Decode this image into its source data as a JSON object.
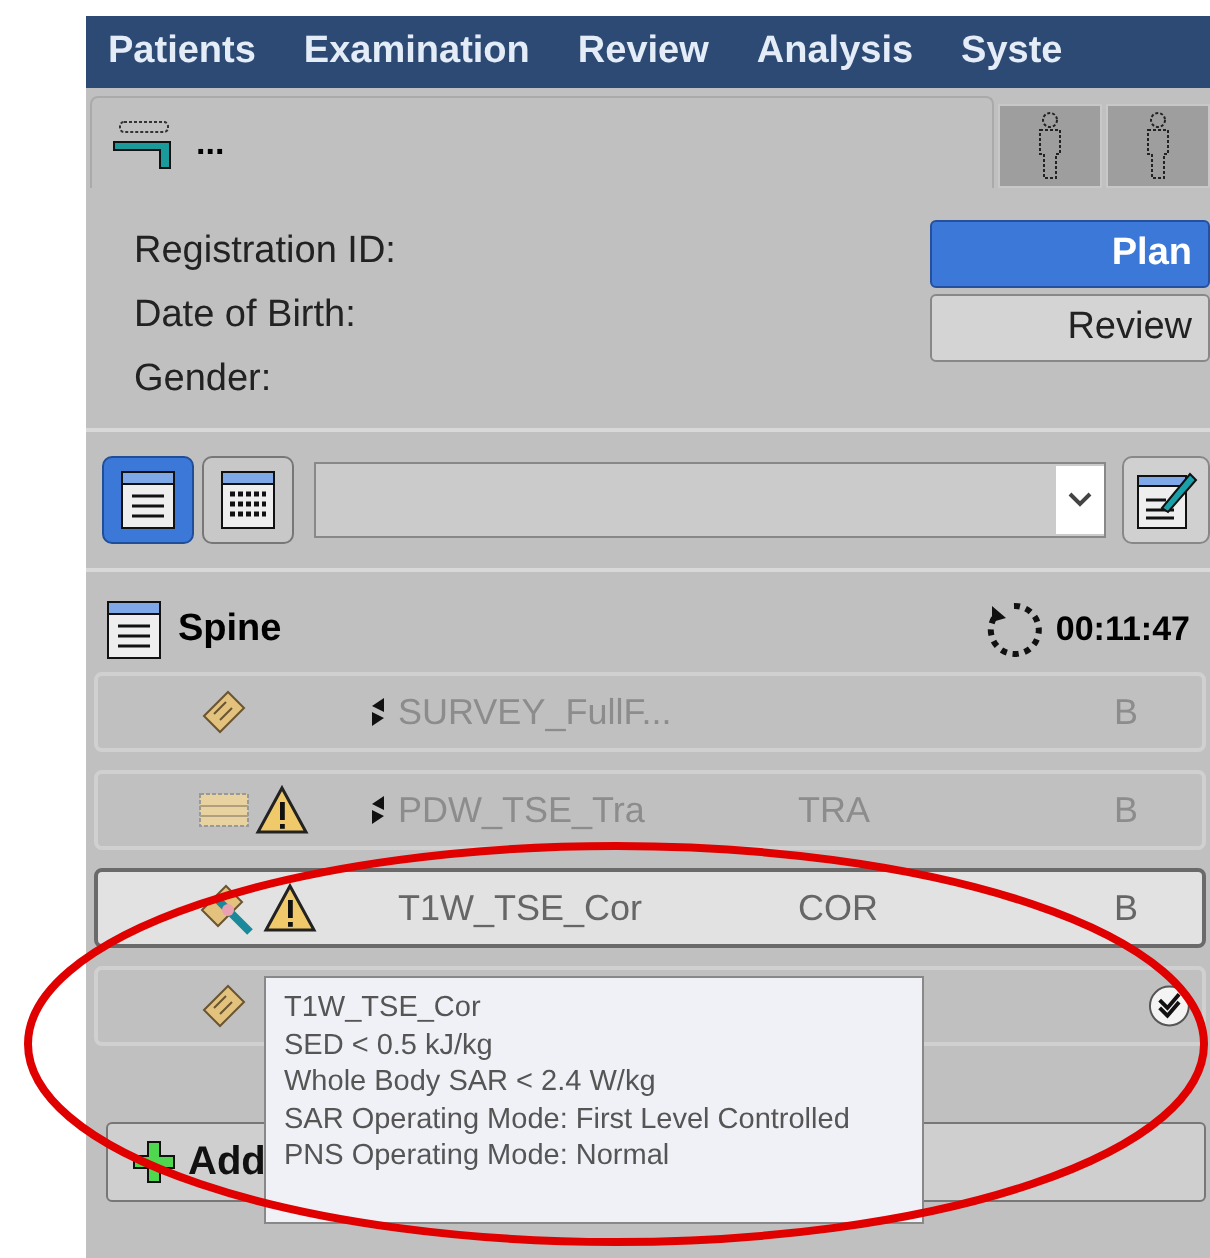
{
  "menu": [
    {
      "label": "Patients"
    },
    {
      "label": "Examination"
    },
    {
      "label": "Review"
    },
    {
      "label": "Analysis"
    },
    {
      "label": "Syste"
    }
  ],
  "patient_tab": {
    "label": "..."
  },
  "side_tabs": [
    {
      "kind": "person"
    },
    {
      "kind": "person"
    }
  ],
  "patient_info": [
    "Registration ID:",
    "Date of Birth:",
    "Gender:"
  ],
  "mode_buttons": [
    {
      "label": "Plan",
      "selected": true
    },
    {
      "label": "Review",
      "selected": false
    }
  ],
  "view_toggles": [
    {
      "kind": "list",
      "selected": true
    },
    {
      "kind": "grid",
      "selected": false
    }
  ],
  "exam": {
    "title": "Spine",
    "duration": "00:11:47"
  },
  "scans": [
    {
      "icons": [
        {
          "kind": "survey"
        }
      ],
      "arrow": true,
      "name": "SURVEY_FullF...",
      "coil": "B",
      "disabled": true,
      "selected": false,
      "done": false
    },
    {
      "icons": [
        {
          "kind": "stack"
        },
        {
          "kind": "warning"
        }
      ],
      "arrow": true,
      "name": "PDW_TSE_Tra",
      "orientation": "TRA",
      "coil": "B",
      "disabled": true,
      "selected": false,
      "done": false
    },
    {
      "icons": [
        {
          "kind": "edit"
        },
        {
          "kind": "warning"
        }
      ],
      "arrow": false,
      "name": "T1W_TSE_Cor",
      "orientation": "COR",
      "coil": "B",
      "disabled": false,
      "selected": true,
      "done": false
    },
    {
      "icons": [
        {
          "kind": "survey"
        }
      ],
      "arrow": false,
      "disabled": false,
      "selected": false,
      "done": true
    }
  ],
  "add_button": {
    "label": "Add"
  },
  "tooltip": [
    "T1W_TSE_Cor",
    "SED  < 0.5 kJ/kg",
    "Whole Body SAR  < 2.4 W/kg",
    "SAR Operating Mode: First Level Controlled",
    "PNS Operating Mode: Normal"
  ]
}
